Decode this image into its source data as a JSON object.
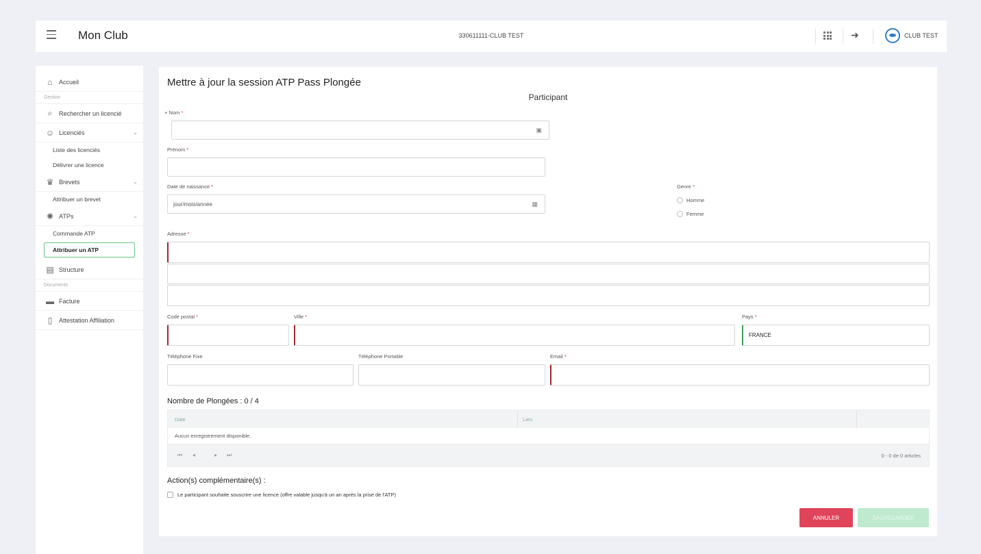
{
  "header": {
    "app_title": "Mon Club",
    "club_id": "330611111-CLUB TEST",
    "club_name": "CLUB TEST"
  },
  "sidebar": {
    "home": "Accueil",
    "section_gestion": "Gestion",
    "search": "Rechercher un licencié",
    "licences": "Licenciés",
    "licences_list": "Liste des licenciés",
    "licence_deliver": "Délivrer une licence",
    "brevets": "Brevets",
    "brevet_assign": "Attribuer un brevet",
    "atps": "ATPs",
    "atp_order": "Commande ATP",
    "atp_assign": "Attribuer un ATP",
    "structure": "Structure",
    "section_documents": "Documents",
    "facture": "Facture",
    "attestation": "Attestation Affiliation"
  },
  "form": {
    "page_title": "Mettre à jour la session ATP Pass Plongée",
    "section_title": "Participant",
    "nom_label": "+ Nom",
    "prenom_label": "Prénom",
    "naissance_label": "Date de naissance",
    "naissance_placeholder": "jour/mois/année",
    "genre_label": "Genre",
    "genre_homme": "Homme",
    "genre_femme": "Femme",
    "adresse_label": "Adresse",
    "code_postal_label": "Code postal",
    "ville_label": "Ville",
    "pays_label": "Pays",
    "pays_value": "FRANCE",
    "tel_fixe_label": "Téléphone Fixe",
    "tel_portable_label": "Téléphone Portable",
    "email_label": "Email",
    "required_mark": "*"
  },
  "dives": {
    "title": "Nombre de Plongées : 0 / 4",
    "col_date": "Date",
    "col_lieu": "Lieu",
    "empty": "Aucun enregistrement disponible.",
    "pager_info": "0 - 0 de 0 articles"
  },
  "actions": {
    "title": "Action(s) complémentaire(s) :",
    "licence_option": "Le participant souhaite souscrire une licence (offre valable jusqu'à un an après la prise de l'ATP)",
    "cancel": "ANNULER",
    "save": "SAUVEGARDER"
  },
  "colors": {
    "error_border": "#9b2830",
    "ok_border": "#3a9a57",
    "cancel_button": "#e0445b",
    "save_button_disabled": "#bfead0"
  }
}
